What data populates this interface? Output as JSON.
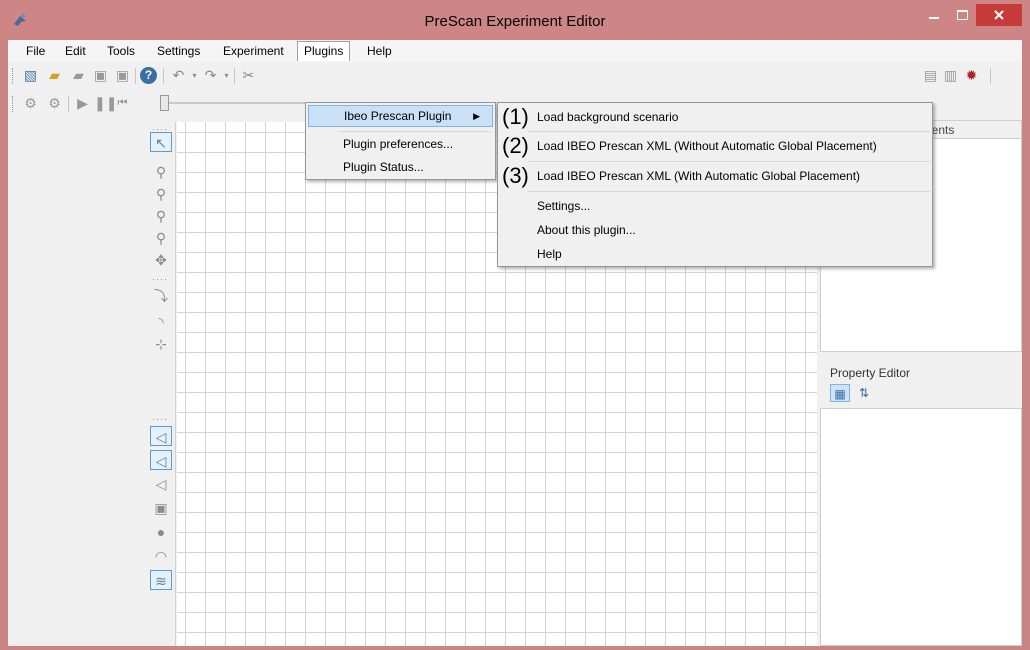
{
  "window": {
    "title": "PreScan Experiment Editor"
  },
  "menubar": {
    "items": [
      "File",
      "Edit",
      "Tools",
      "Settings",
      "Experiment",
      "Plugins",
      "Help"
    ],
    "active": "Plugins"
  },
  "plugins_menu": {
    "items": [
      {
        "label": "Ibeo Prescan Plugin",
        "has_submenu": true,
        "highlighted": true
      },
      {
        "label": "Plugin preferences..."
      },
      {
        "label": "Plugin Status..."
      }
    ]
  },
  "ibeo_submenu": {
    "items": [
      {
        "callout": "(1)",
        "label": "Load background scenario"
      },
      {
        "callout": "(2)",
        "label": "Load IBEO Prescan XML (Without Automatic Global Placement)"
      },
      {
        "callout": "(3)",
        "label": "Load IBEO Prescan XML (With Automatic Global Placement)"
      },
      {
        "label": "Settings..."
      },
      {
        "label": "About this plugin..."
      },
      {
        "label": "Help"
      }
    ]
  },
  "right_panel": {
    "top_title_partial": "nents"
  },
  "property_editor": {
    "title": "Property Editor"
  },
  "colors": {
    "titlebar": "#cd8586",
    "close_button": "#c73a3a",
    "highlight": "#c9e0f7"
  }
}
